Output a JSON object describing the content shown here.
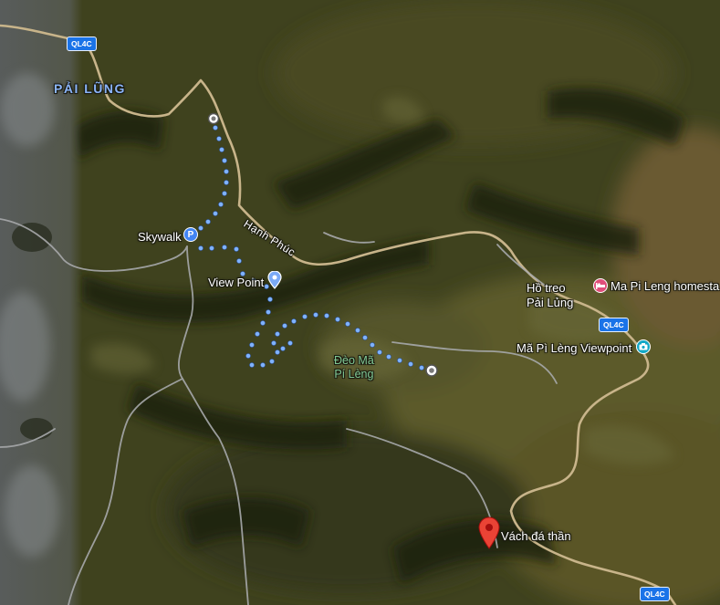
{
  "map": {
    "labels": {
      "town": "PẢI LŨNG",
      "skywalk": "Skywalk",
      "viewpoint": "View Point",
      "road_name": "Hạnh Phúc",
      "pass_line1": "Đèo Mã",
      "pass_line2": "Pí Lèng",
      "bridge_line1": "Hồ treo",
      "bridge_line2": "Pải Lủng",
      "homestay": "Ma Pi Leng homesta",
      "mapileng_viewpoint": "Mã Pì Lèng Viewpoint",
      "destination": "Vách đá thần"
    },
    "road_shields": {
      "nw": "QL4C",
      "mid": "QL4C",
      "se": "QL4C"
    },
    "icons": {
      "skywalk": "parking-icon",
      "viewpoint": "place-pin-icon",
      "homestay": "lodging-icon",
      "mapileng_viewpoint": "camera-icon",
      "destination": "red-location-pin-icon",
      "route_start": "route-start-circle-icon",
      "route_end": "route-end-circle-icon"
    },
    "colors": {
      "route": "#7fb2ff",
      "highway_shield": "#1a73e8",
      "road": "#c3b089",
      "place_label_green": "#81c995",
      "town_label": "#8ab4f8",
      "destination_pin": "#ea4335",
      "homestay_pin": "#e04f7a",
      "viewpoint_pin": "#12a8c6"
    }
  }
}
